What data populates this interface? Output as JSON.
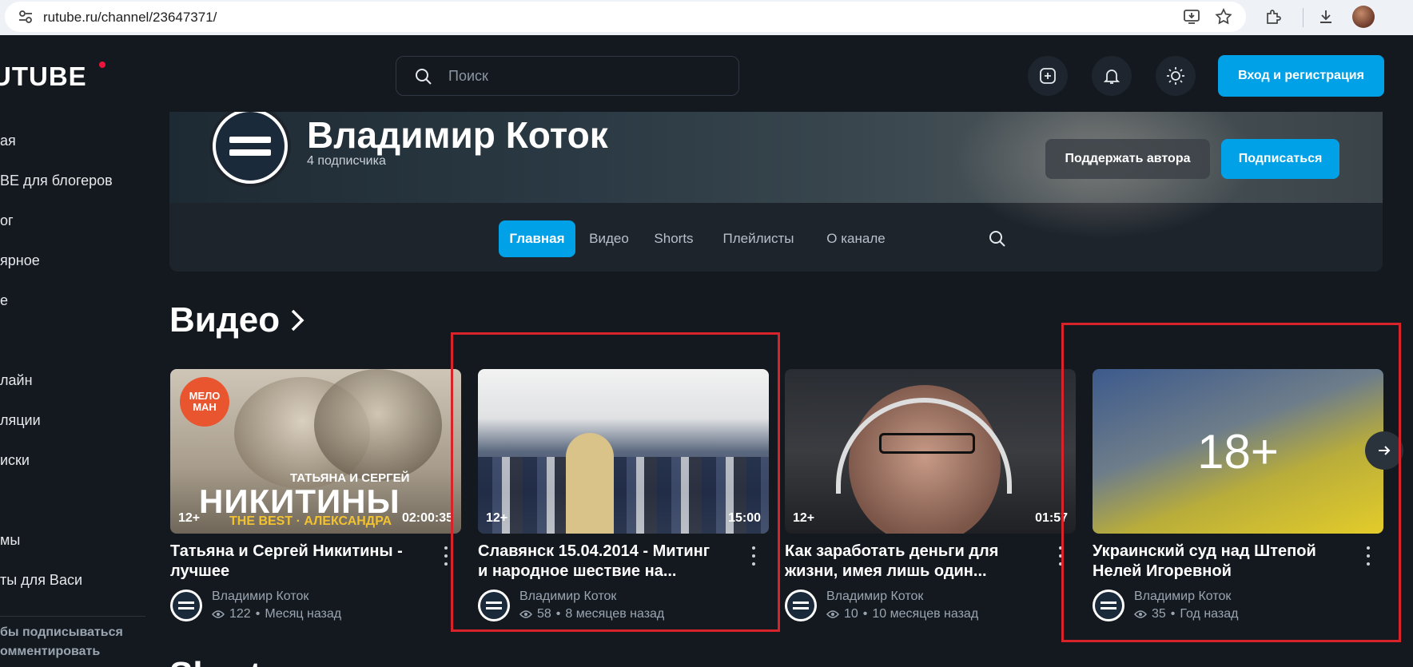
{
  "browser": {
    "url": "rutube.ru/channel/23647371/"
  },
  "header": {
    "logo": "UTUBE",
    "search_placeholder": "Поиск",
    "login_label": "Вход и регистрация"
  },
  "sidebar": {
    "items": [
      "ая",
      "BE для блогеров",
      "ог",
      "ярное",
      "е",
      "лайн",
      "ляции",
      "иски",
      "мы",
      "ты для Васи"
    ],
    "hint_line1": "бы подписываться",
    "hint_line2": "омментировать"
  },
  "channel": {
    "name": "Владимир Коток",
    "subscribers": "4 подписчика",
    "support_label": "Поддержать автора",
    "subscribe_label": "Подписаться",
    "tabs": [
      "Главная",
      "Видео",
      "Shorts",
      "Плейлисты",
      "О канале"
    ]
  },
  "videos_section": {
    "title": "Видео",
    "videos": [
      {
        "title_line1": "Татьяна и Сергей Никитины -",
        "title_line2": "лучшее",
        "author": "Владимир Коток",
        "views": "122",
        "age": "Месяц назад",
        "rating": "12+",
        "duration": "02:00:35",
        "thumb_text_top": "ТАТЬЯНА И СЕРГЕЙ",
        "thumb_text_main": "НИКИТИНЫ",
        "thumb_text_sub": "THE BEST · АЛЕКСАНДРА",
        "thumb_logo": "МЕЛО МАН"
      },
      {
        "title_line1": "Славянск 15.04.2014 - Митинг",
        "title_line2": "и народное шествие на...",
        "author": "Владимир Коток",
        "views": "58",
        "age": "8 месяцев назад",
        "rating": "12+",
        "duration": "15:00"
      },
      {
        "title_line1": "Как заработать деньги для",
        "title_line2": "жизни, имея лишь один...",
        "author": "Владимир Коток",
        "views": "10",
        "age": "10 месяцев назад",
        "rating": "12+",
        "duration": "01:57"
      },
      {
        "title_line1": "Украинский суд над Штепой",
        "title_line2": "Нелей Игоревной",
        "author": "Владимир Коток",
        "views": "35",
        "age": "Год назад",
        "rating": "18+",
        "duration": ""
      }
    ]
  },
  "shorts_section": {
    "title": "Shorts"
  },
  "colors": {
    "accent": "#00a1e7",
    "highlight_box": "#d8232a",
    "logo_dot": "#ed143b"
  }
}
